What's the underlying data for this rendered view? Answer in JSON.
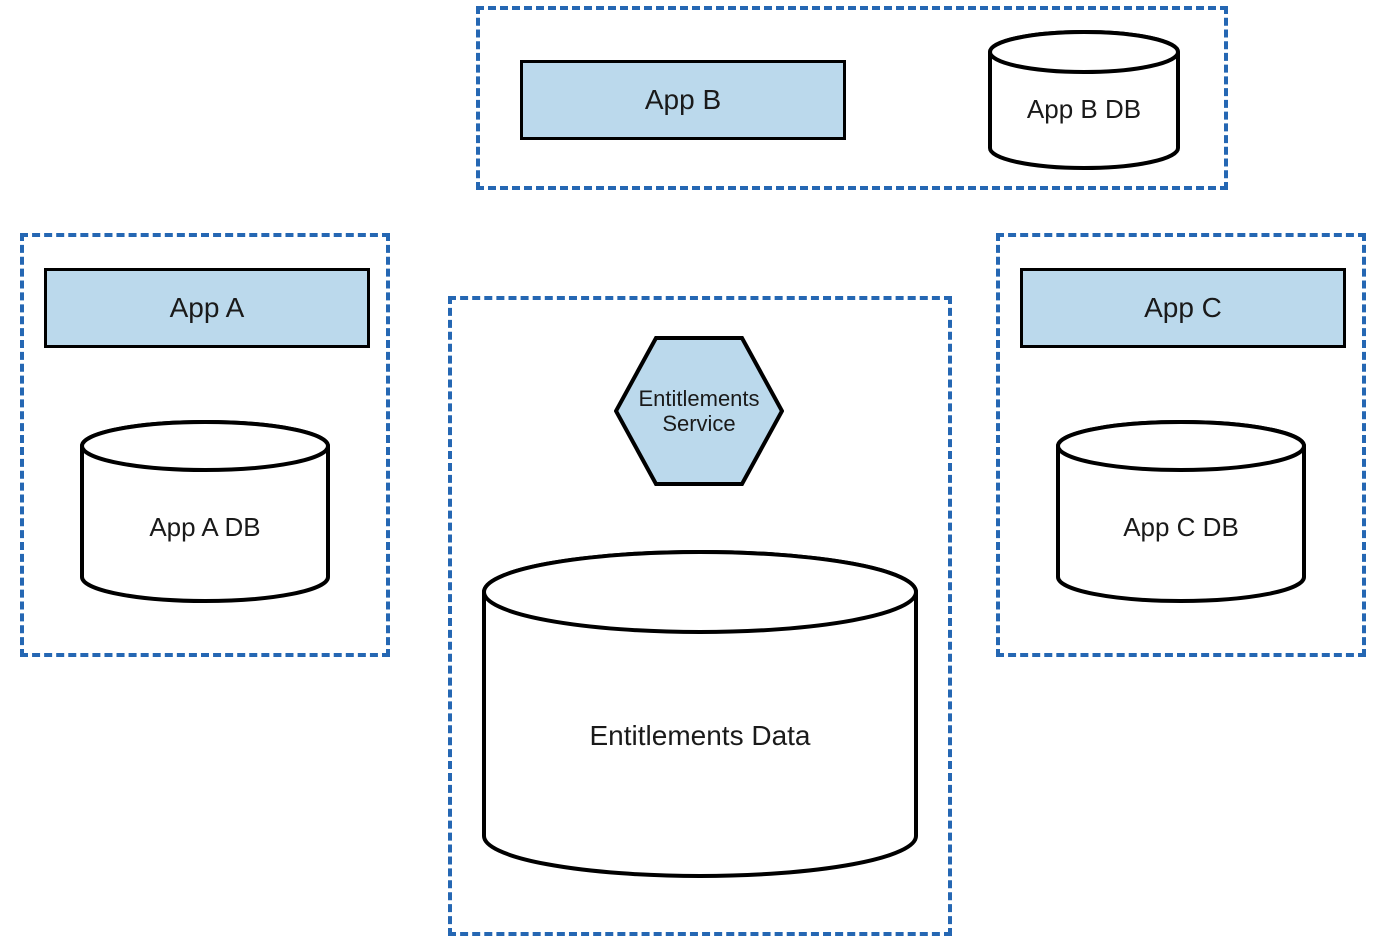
{
  "boxes": {
    "appA": {
      "app": "App A",
      "db": "App A DB"
    },
    "appB": {
      "app": "App B",
      "db": "App B DB"
    },
    "appC": {
      "app": "App C",
      "db": "App C DB"
    },
    "entitlements": {
      "serviceLine1": "Entitlements",
      "serviceLine2": "Service",
      "data": "Entitlements Data"
    }
  },
  "colors": {
    "boxFill": "#bbd9ec",
    "border": "#000000",
    "dashBorder": "#2567b3",
    "background": "#ffffff"
  },
  "diagram": {
    "description": "Architecture diagram with three application boundaries (App A, App B, App C), each with its own DB cylinder, and a central Entitlements Service hexagon with an Entitlements Data cylinder enclosed in a dashed boundary."
  }
}
